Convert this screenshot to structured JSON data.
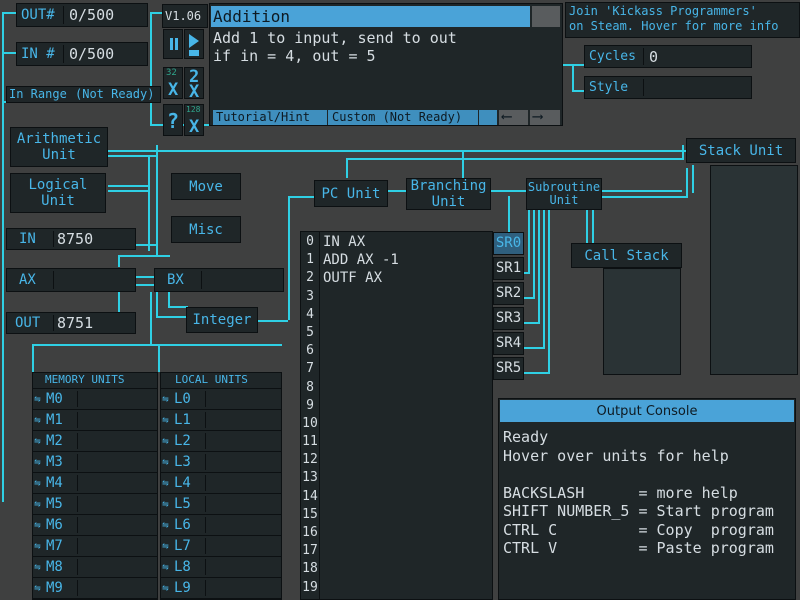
{
  "io": {
    "out_label": "OUT#",
    "out_value": "0/500",
    "in_label": "IN #",
    "in_value": "0/500",
    "range_label": "In Range",
    "range_value": "(Not Ready)"
  },
  "version": "V1.06",
  "controls": {
    "pause_icon": "pause-icon",
    "step_icon": "step-icon",
    "x32_small": "32",
    "x32_big": "2",
    "x32_x": "X",
    "x128_small": "128",
    "x128_big": "2",
    "x128_x": "X",
    "help": "?"
  },
  "task": {
    "title": "Addition",
    "description_line1": "Add 1 to input, send to out",
    "description_line2": "if in = 4, out = 5",
    "tab_tutorial": "Tutorial/Hint",
    "tab_custom": "Custom (Not Ready)"
  },
  "steam": {
    "line1": "Join 'Kickass Programmers'",
    "line2": "on Steam. Hover for more info"
  },
  "stats": {
    "cycles_label": "Cycles",
    "cycles_value": "0",
    "style_label": "Style",
    "style_value": ""
  },
  "units": {
    "arithmetic": "Arithmetic Unit",
    "logical": "Logical Unit",
    "move": "Move",
    "misc": "Misc",
    "pc": "PC Unit",
    "branching": "Branching Unit",
    "subroutine": "Subroutine Unit",
    "stack": "Stack Unit",
    "call_stack": "Call Stack",
    "integer": "Integer"
  },
  "registers": {
    "in_label": "IN",
    "in_value": "8750",
    "ax_label": "AX",
    "ax_value": "",
    "bx_label": "BX",
    "bx_value": "",
    "out_label": "OUT",
    "out_value": "8751"
  },
  "program": {
    "line_numbers": [
      "0",
      "1",
      "2",
      "3",
      "4",
      "5",
      "6",
      "7",
      "8",
      "9",
      "10",
      "11",
      "12",
      "13",
      "14",
      "15",
      "16",
      "17",
      "18",
      "19"
    ],
    "lines": [
      "IN AX",
      "ADD AX -1",
      "OUTF AX",
      "",
      "",
      "",
      "",
      "",
      "",
      "",
      "",
      "",
      "",
      "",
      "",
      "",
      "",
      "",
      "",
      ""
    ]
  },
  "subroutines": [
    "SR0",
    "SR1",
    "SR2",
    "SR3",
    "SR4",
    "SR5"
  ],
  "memory": {
    "memory_title": "MEMORY UNITS",
    "local_title": "LOCAL UNITS",
    "m_labels": [
      "M0",
      "M1",
      "M2",
      "M3",
      "M4",
      "M5",
      "M6",
      "M7",
      "M8",
      "M9"
    ],
    "l_labels": [
      "L0",
      "L1",
      "L2",
      "L3",
      "L4",
      "L5",
      "L6",
      "L7",
      "L8",
      "L9"
    ]
  },
  "console": {
    "title": "Output Console",
    "lines": [
      "Ready",
      "Hover over units for help",
      "",
      "BACKSLASH      = more help",
      "SHIFT NUMBER_5 = Start program",
      "CTRL C         = Copy  program",
      "CTRL V         = Paste program"
    ]
  },
  "colors": {
    "accent": "#48b6e8",
    "wire": "#2fd0e4",
    "panel": "#1f2628",
    "background": "#3f4040",
    "highlight": "#4aa3d8"
  }
}
